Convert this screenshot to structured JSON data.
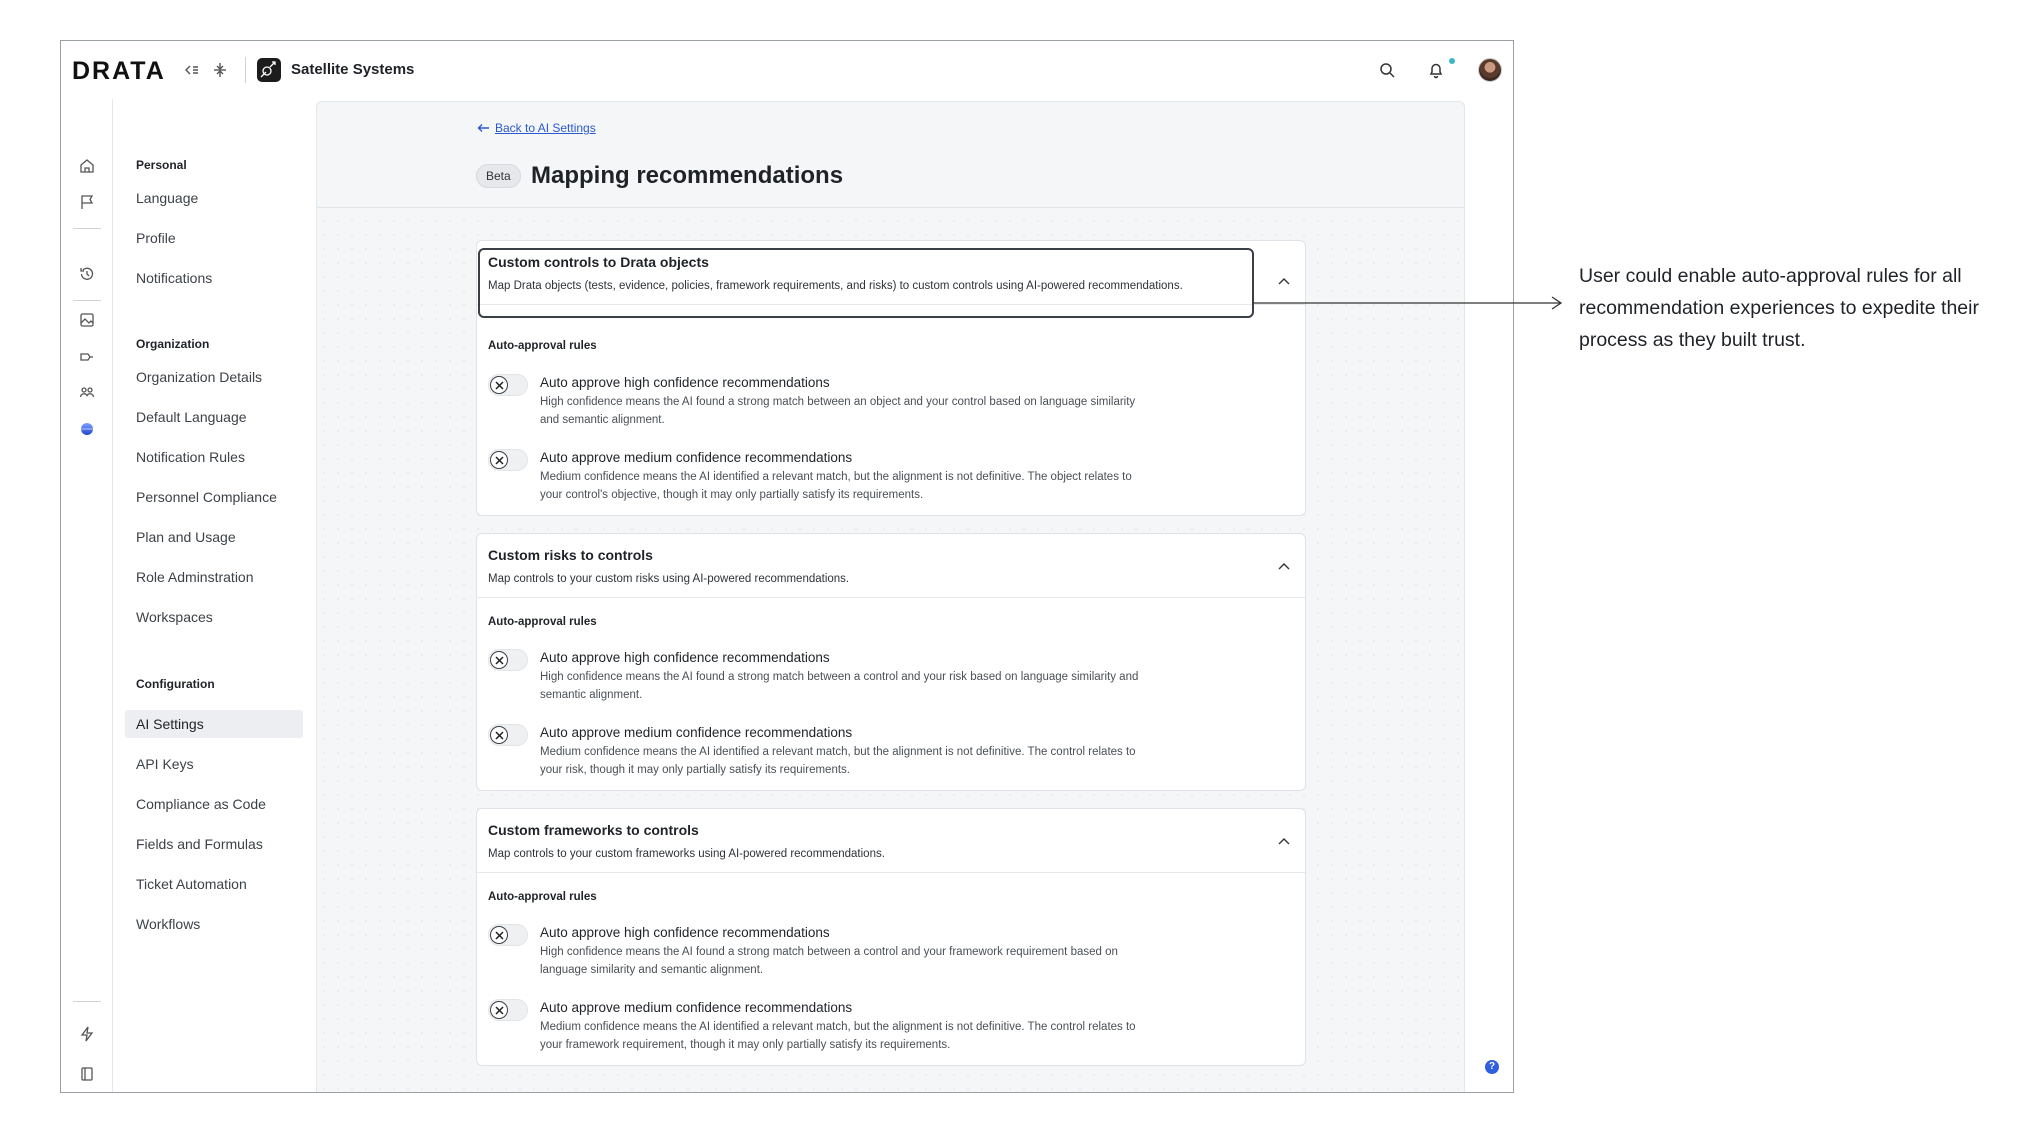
{
  "topbar": {
    "logo": "DRATA",
    "org_name": "Satellite Systems",
    "icons": [
      "collapse-icon",
      "switch-icon",
      "search-icon",
      "bell-icon",
      "avatar"
    ]
  },
  "rail": {
    "icons": [
      "home-icon",
      "flag-icon",
      "history-icon",
      "image-icon",
      "risk-icon",
      "people-icon",
      "globe-icon",
      "bolt-icon",
      "book-icon",
      "settings-icon"
    ]
  },
  "nav": {
    "personal_heading": "Personal",
    "personal": [
      "Language",
      "Profile",
      "Notifications"
    ],
    "org_heading": "Organization",
    "organization": [
      "Organization Details",
      "Default Language",
      "Notification Rules",
      "Personnel Compliance",
      "Plan and Usage",
      "Role Adminstration",
      "Workspaces"
    ],
    "config_heading": "Configuration",
    "configuration": [
      "AI Settings",
      "API Keys",
      "Compliance as Code",
      "Fields and Formulas",
      "Ticket Automation",
      "Workflows"
    ],
    "active": "AI Settings"
  },
  "main": {
    "back_link": "Back to AI Settings",
    "badge": "Beta",
    "title": "Mapping recommendations",
    "sections": [
      {
        "title": "Custom controls to Drata objects",
        "desc": "Map Drata objects (tests, evidence, policies, framework requirements, and risks) to custom controls using AI-powered recommendations.",
        "rules_heading": "Auto-approval rules",
        "rules": [
          {
            "title": "Auto approve high confidence recommendations",
            "desc": "High confidence means the AI found a strong match between an object and your control based on language similarity and semantic alignment.",
            "enabled": false
          },
          {
            "title": "Auto approve medium confidence recommendations",
            "desc": "Medium confidence means the AI identified a relevant match, but the alignment is not definitive. The object relates to your control's objective, though it may only partially satisfy its requirements.",
            "enabled": false
          }
        ]
      },
      {
        "title": "Custom risks to controls",
        "desc": "Map controls to your custom risks using AI-powered recommendations.",
        "rules_heading": "Auto-approval rules",
        "rules": [
          {
            "title": "Auto approve high confidence recommendations",
            "desc": "High confidence means the AI found a strong match between a control and your risk based on language similarity and semantic alignment.",
            "enabled": false
          },
          {
            "title": "Auto approve medium confidence recommendations",
            "desc": "Medium confidence means the AI identified a relevant match, but the alignment is not definitive. The control relates to your risk, though it may only partially satisfy its requirements.",
            "enabled": false
          }
        ]
      },
      {
        "title": "Custom frameworks to controls",
        "desc": "Map controls to your custom frameworks using AI-powered recommendations.",
        "rules_heading": "Auto-approval rules",
        "rules": [
          {
            "title": "Auto approve high confidence recommendations",
            "desc": "High confidence means the AI found a strong match between a control and your framework requirement based on language similarity and semantic alignment.",
            "enabled": false
          },
          {
            "title": "Auto approve medium confidence recommendations",
            "desc": "Medium confidence means the AI identified a relevant match, but the alignment is not definitive. The control relates to your framework requirement, though it may only partially satisfy its requirements.",
            "enabled": false
          }
        ]
      }
    ]
  },
  "help": "?",
  "annotation": "User could enable auto-approval rules for all recommendation experiences to expedite their process as they built trust."
}
